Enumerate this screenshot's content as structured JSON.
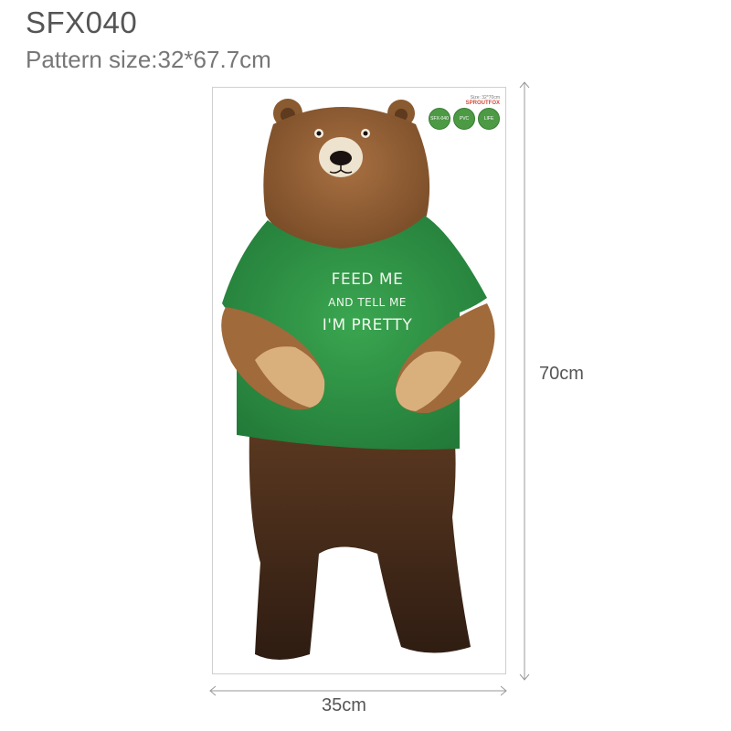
{
  "product": {
    "code": "SFX040",
    "pattern_size": "Pattern size:32*67.7cm"
  },
  "sticker": {
    "shirt_text": [
      "FEED ME",
      "AND TELL ME",
      "I'M PRETTY"
    ],
    "badges": [
      "SFX-040",
      "PVC",
      "LIFE"
    ],
    "brand": "SPROUTFOX",
    "size_note": "Size: 32*70cm",
    "colors": {
      "fur": "#8a5a30",
      "fur_dark": "#3f2617",
      "shirt": "#2e9a48",
      "paw": "#d9b07c"
    }
  },
  "dimensions": {
    "height": "70cm",
    "width": "35cm"
  }
}
